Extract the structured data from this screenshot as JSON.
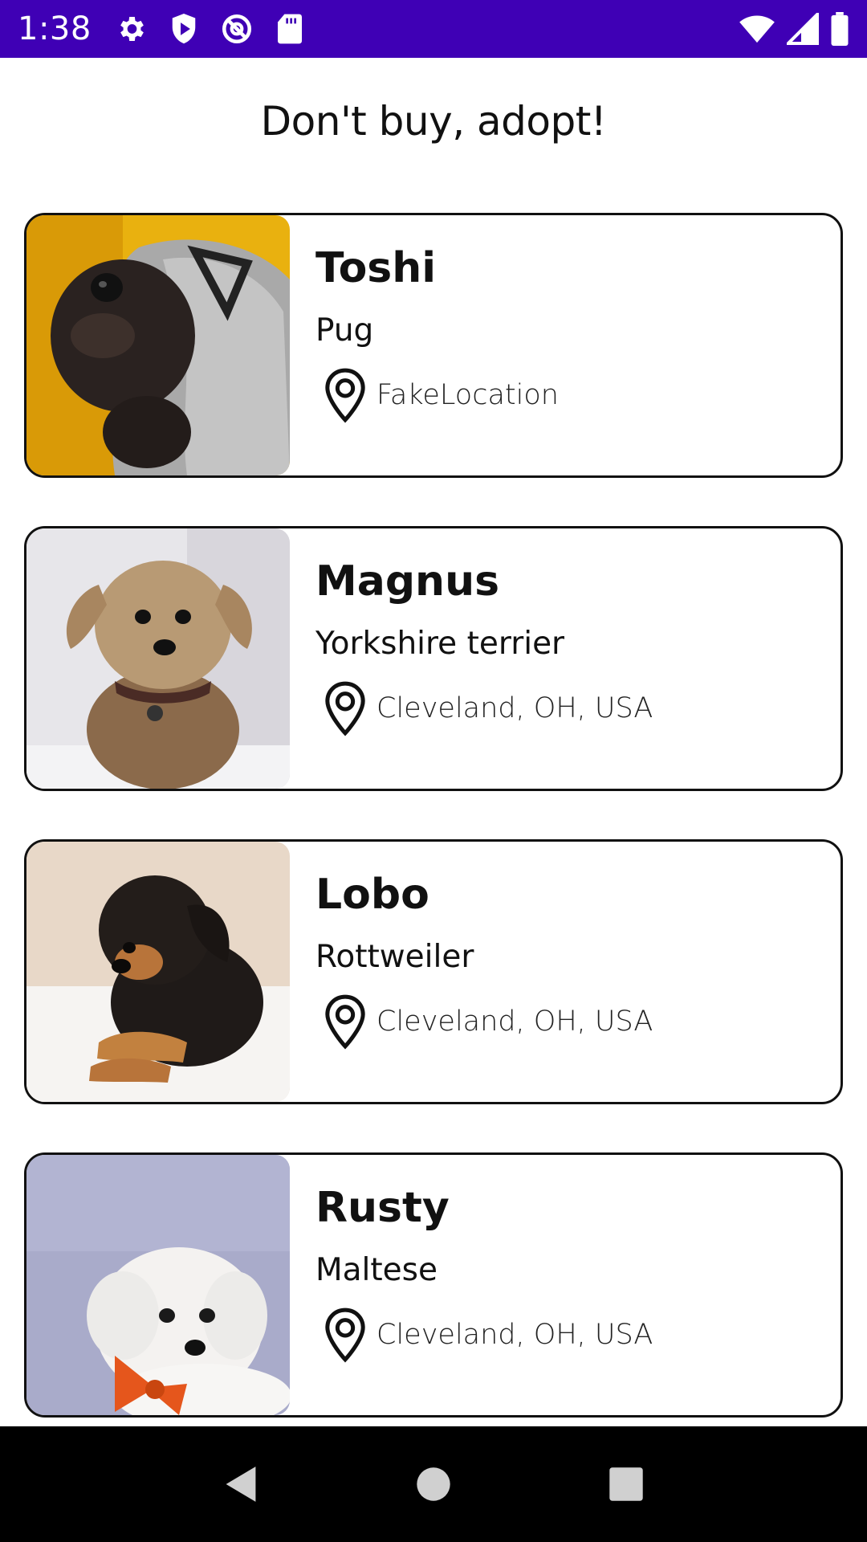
{
  "status_bar": {
    "time": "1:38",
    "icons_left": [
      "gear-icon",
      "play-shield-icon",
      "sync-blocked-icon",
      "sd-card-icon"
    ],
    "icons_right": [
      "wifi-icon",
      "signal-icon",
      "battery-icon"
    ],
    "background": "#3f00b5"
  },
  "header": {
    "title": "Don't buy, adopt!"
  },
  "pets": [
    {
      "name": "Toshi",
      "breed": "Pug",
      "location": "FakeLocation",
      "photo": "pug-in-grey-hoodie-photo"
    },
    {
      "name": "Magnus",
      "breed": "Yorkshire terrier",
      "location": "Cleveland, OH, USA",
      "photo": "yorkshire-terrier-photo"
    },
    {
      "name": "Lobo",
      "breed": "Rottweiler",
      "location": "Cleveland, OH, USA",
      "photo": "rottweiler-puppy-photo"
    },
    {
      "name": "Rusty",
      "breed": "Maltese",
      "location": "Cleveland, OH, USA",
      "photo": "maltese-with-bowtie-photo"
    }
  ],
  "nav_bar": {
    "buttons": [
      "back-icon",
      "home-icon",
      "recents-icon"
    ]
  }
}
